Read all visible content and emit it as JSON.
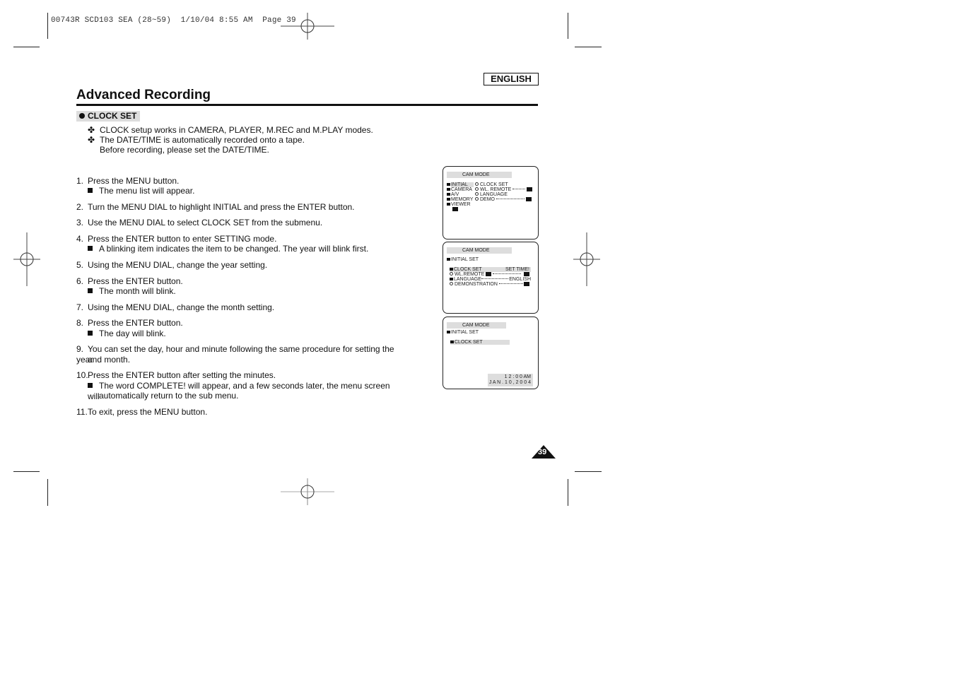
{
  "slug": "00743R SCD103 SEA (28~59)  1/10/04 8:55 AM  Page 39",
  "language_label": "ENGLISH",
  "page_title": "Advanced Recording",
  "section_label": "CLOCK SET",
  "notes": [
    "CLOCK setup works in CAMERA, PLAYER, M.REC and M.PLAY modes.",
    "The DATE/TIME is automatically recorded onto a tape.",
    "Before recording, please set the DATE/TIME."
  ],
  "note_symbol": "✤",
  "steps": [
    {
      "num": "1.",
      "text": "Press the MENU button.",
      "sub": "The menu list will appear."
    },
    {
      "num": "2.",
      "text": "Turn the MENU DIAL to highlight INITIAL and press the ENTER button."
    },
    {
      "num": "3.",
      "text": "Use the MENU DIAL to select CLOCK SET from the submenu."
    },
    {
      "num": "4.",
      "text": "Press the ENTER button to enter SETTING mode.",
      "sub": "A blinking item indicates the item to be changed. The year will blink first."
    },
    {
      "num": "5.",
      "text": "Using the MENU DIAL, change the year setting."
    },
    {
      "num": "6.",
      "text": "Press the ENTER button.",
      "sub": "The month will blink."
    },
    {
      "num": "7.",
      "text": "Using the MENU DIAL, change the month setting."
    },
    {
      "num": "8.",
      "text": "Press the ENTER button.",
      "sub": "The day will blink."
    },
    {
      "num": "9.",
      "text": "You can set the day, hour and minute following the same procedure for setting the year",
      "text2": "and month."
    },
    {
      "num": "10.",
      "text": "Press the ENTER button after setting the minutes.",
      "sub": "The word COMPLETE! will appear, and a few seconds later, the menu screen will",
      "sub2": "automatically return to the sub menu."
    },
    {
      "num": "11.",
      "text": "To exit, press the MENU button."
    }
  ],
  "screens": [
    {
      "header": "CAM  MODE",
      "left_menu": [
        "INITIAL",
        "CAMERA",
        "A/V",
        "MEMORY",
        "VIEWER"
      ],
      "right_menu": [
        "CLOCK  SET",
        "WL. REMOTE",
        "LANGUAGE",
        "DEMO"
      ]
    },
    {
      "header": "CAM  MODE",
      "parent": "INITIAL SET",
      "items": [
        {
          "label": "CLOCK  SET",
          "value": "SET TIME!"
        },
        {
          "label": "WL.REMOTE",
          "value": ""
        },
        {
          "label": "LANGUAGE",
          "value": "ENGLISH"
        },
        {
          "label": "DEMONSTRATION",
          "value": ""
        }
      ]
    },
    {
      "header": "CAM  MODE",
      "parent": "INITIAL SET",
      "item": "CLOCK  SET",
      "time": "1 2 : 0 0 AM",
      "date": "J A N . 1 0 , 2 0 0 4"
    }
  ],
  "page_number": "39"
}
